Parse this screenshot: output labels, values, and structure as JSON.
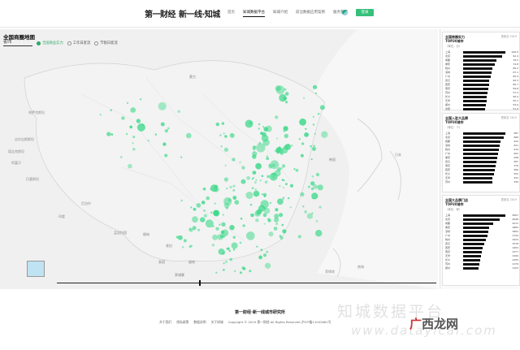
{
  "nav": {
    "brand_primary": "第一财经",
    "brand_secondary": "新一线·知城",
    "links": [
      {
        "label": "首页",
        "active": false
      },
      {
        "label": "知城数据平台",
        "active": true
      },
      {
        "label": "知城介绍",
        "active": false
      },
      {
        "label": "前沿数据应用案例",
        "active": false
      },
      {
        "label": "服务我们",
        "active": false
      }
    ],
    "cta_label": "登录",
    "accent_color": "#36c07a"
  },
  "map": {
    "title": "全国商圈地图",
    "city_select": "省/市",
    "tabs": [
      {
        "label": "全国商业实力",
        "active": true
      },
      {
        "label": "工作日客流",
        "active": false
      },
      {
        "label": "节假日客流",
        "active": false
      }
    ],
    "labels": {
      "mongolia": "蒙古",
      "kazakhstan": "哈萨克斯坦",
      "kyrgyzstan": "吉尔吉斯斯坦",
      "tajikistan": "塔吉克斯坦",
      "afghanistan": "阿富汗",
      "pakistan": "巴基斯坦",
      "india": "印度",
      "nepal": "尼泊尔",
      "bangladesh": "孟加拉国",
      "myanmar": "缅甸",
      "laos": "老挝",
      "thailand": "泰国",
      "vietnam": "越南",
      "cambodia": "柬埔寨",
      "korea": "韩国",
      "japan": "日本",
      "philippines": "菲律宾",
      "south_sea": "南海"
    },
    "bubble_color": "#3ed98a"
  },
  "rankings": [
    {
      "title": "全国商圈实力",
      "subtitle": "TOP30城市",
      "meta": "（单位：分）",
      "info": "更新至 2019",
      "rows": [
        {
          "city": "上海",
          "value": "100.0"
        },
        {
          "city": "北京",
          "value": "92.4"
        },
        {
          "city": "成都",
          "value": "79.5"
        },
        {
          "city": "重庆",
          "value": "74.8"
        },
        {
          "city": "杭州",
          "value": "69.2"
        },
        {
          "city": "深圳",
          "value": "67.1"
        },
        {
          "city": "广州",
          "value": "65.9"
        },
        {
          "city": "武汉",
          "value": "62.3"
        },
        {
          "city": "西安",
          "value": "60.7"
        },
        {
          "city": "南京",
          "value": "59.8"
        },
        {
          "city": "苏州",
          "value": "57.2"
        },
        {
          "city": "长沙",
          "value": "56.4"
        },
        {
          "city": "天津",
          "value": "55.1"
        },
        {
          "city": "郑州",
          "value": "53.0"
        },
        {
          "city": "沈阳",
          "value": "51.6"
        }
      ]
    },
    {
      "title": "全国入驻大品牌",
      "subtitle": "TOP30城市",
      "meta": "（单位：个）",
      "info": "更新至 2019",
      "rows": [
        {
          "city": "上海",
          "value": "487"
        },
        {
          "city": "北京",
          "value": "466"
        },
        {
          "city": "成都",
          "value": "432"
        },
        {
          "city": "深圳",
          "value": "421"
        },
        {
          "city": "杭州",
          "value": "410"
        },
        {
          "city": "广州",
          "value": "402"
        },
        {
          "city": "重庆",
          "value": "398"
        },
        {
          "city": "武汉",
          "value": "387"
        },
        {
          "city": "南京",
          "value": "379"
        },
        {
          "city": "西安",
          "value": "366"
        },
        {
          "city": "长沙",
          "value": "352"
        },
        {
          "city": "天津",
          "value": "341"
        },
        {
          "city": "苏州",
          "value": "336"
        }
      ]
    },
    {
      "title": "全国大品牌门店",
      "subtitle": "TOP30城市",
      "meta": "（单位：家）",
      "info": "更新至 2019",
      "rows": [
        {
          "city": "上海",
          "value": "3067"
        },
        {
          "city": "北京",
          "value": "2648"
        },
        {
          "city": "成都",
          "value": "2211"
        },
        {
          "city": "重庆",
          "value": "1883"
        },
        {
          "city": "深圳",
          "value": "1802"
        },
        {
          "city": "广州",
          "value": "1744"
        },
        {
          "city": "杭州",
          "value": "1632"
        },
        {
          "city": "武汉",
          "value": "1518"
        },
        {
          "city": "西安",
          "value": "1402"
        },
        {
          "city": "南京",
          "value": "1377"
        },
        {
          "city": "天津",
          "value": "1290"
        },
        {
          "city": "长沙",
          "value": "1255"
        },
        {
          "city": "苏州",
          "value": "1176"
        },
        {
          "city": "郑州",
          "value": "1103"
        }
      ]
    }
  ],
  "footer": {
    "title": "第一财经·新一线城市研究所",
    "links": [
      "关于我们",
      "隐私政策",
      "数据说明",
      "关于知城"
    ],
    "copyright": "Copyright © 2019 第一财经 All Rights Reserved 沪ICP备11042661号"
  },
  "watermark": {
    "line1": "知城数据平台",
    "line2": "www.datayicai.com",
    "logo_left": "广",
    "logo_right": "西龙网"
  }
}
